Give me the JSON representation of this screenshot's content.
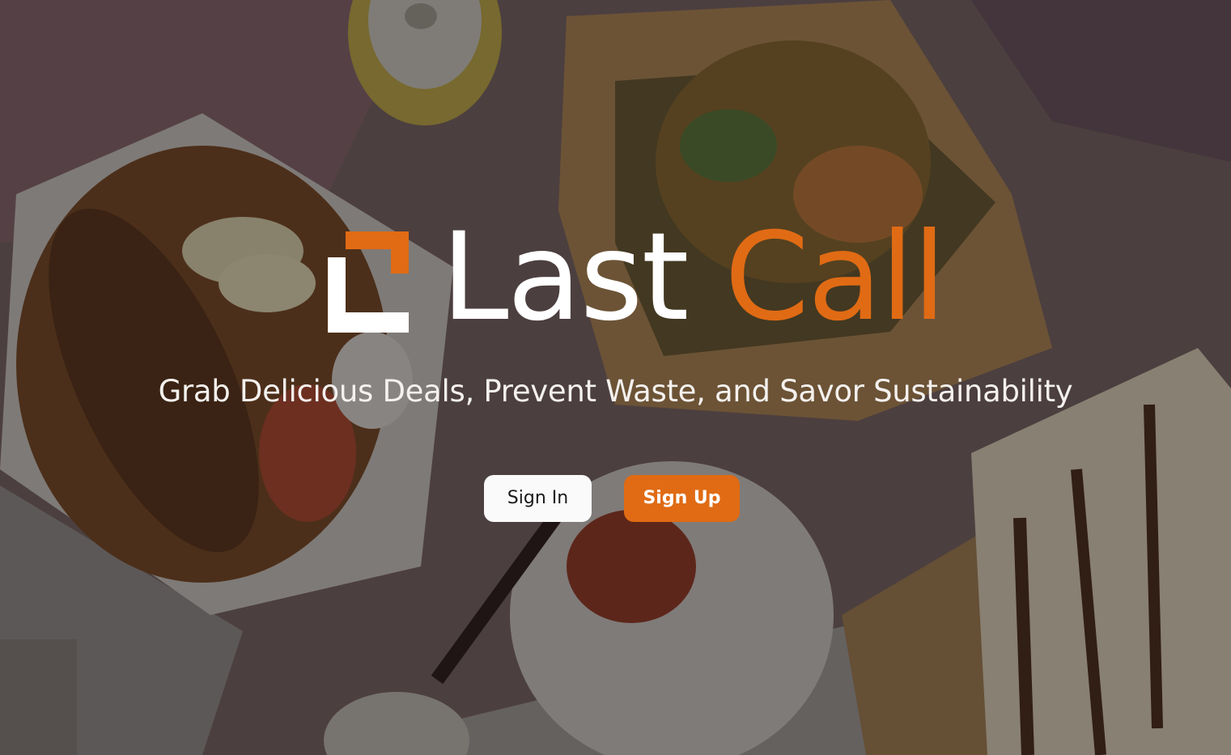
{
  "brand": {
    "logo_icon": "last-call-bracket-logo",
    "name_part1": "Last",
    "name_part2": "Call",
    "accent_color": "#e06b14"
  },
  "hero": {
    "tagline": "Grab Delicious Deals, Prevent Waste, and Savor Sustainability",
    "background": "food-takeout-photo"
  },
  "actions": {
    "sign_in_label": "Sign In",
    "sign_up_label": "Sign Up"
  }
}
